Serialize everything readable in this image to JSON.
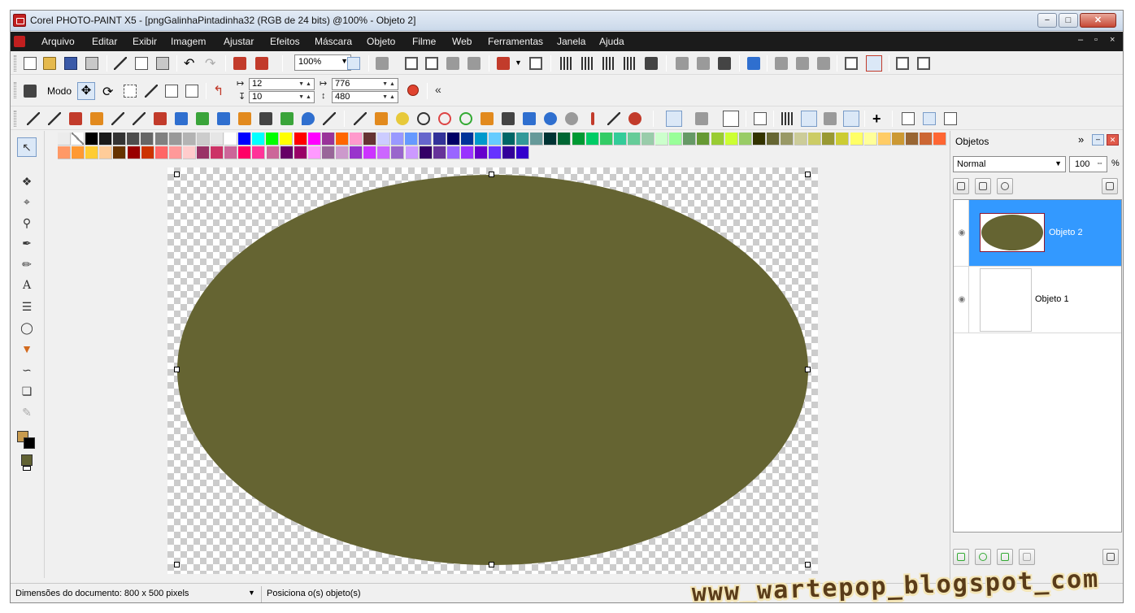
{
  "window": {
    "title": "Corel PHOTO-PAINT X5 - [pngGalinhaPintadinha32 (RGB de 24 bits) @100% - Objeto 2]",
    "controls": {
      "minimize": "−",
      "maximize": "□",
      "close": "✕"
    }
  },
  "menu": {
    "items": [
      "Arquivo",
      "Editar",
      "Exibir",
      "Imagem",
      "Ajustar",
      "Efeitos",
      "Máscara",
      "Objeto",
      "Filme",
      "Web",
      "Ferramentas",
      "Janela",
      "Ajuda"
    ],
    "doc_controls": [
      "–",
      "▫",
      "×"
    ]
  },
  "toolbar_standard": {
    "zoom": "100%"
  },
  "property_bar": {
    "mode_label": "Modo",
    "pos_x": "12",
    "pos_y": "10",
    "width": "776",
    "height": "480"
  },
  "palette_colors": [
    "#000000",
    "#1a1a1a",
    "#333333",
    "#4d4d4d",
    "#666666",
    "#808080",
    "#999999",
    "#b3b3b3",
    "#cccccc",
    "#e6e6e6",
    "#ffffff",
    "#0000ff",
    "#00ffff",
    "#00ff00",
    "#ffff00",
    "#ff0000",
    "#ff00ff",
    "#993399",
    "#ff6600",
    "#ff99cc",
    "#663333",
    "#ccccff",
    "#9999ff",
    "#6699ff",
    "#6666cc",
    "#333399",
    "#000066",
    "#003399",
    "#0099cc",
    "#66ccff",
    "#006666",
    "#339999",
    "#669999",
    "#003333",
    "#006633",
    "#009933",
    "#00cc66",
    "#33cc66",
    "#33cc99",
    "#66cc99",
    "#99ccaa",
    "#ccffcc",
    "#99ff99",
    "#669966",
    "#669933",
    "#99cc33",
    "#ccff33",
    "#99cc66",
    "#333300",
    "#666633",
    "#999966",
    "#cccc99",
    "#cccc66",
    "#999933",
    "#cccc33",
    "#ffff66",
    "#ffff99",
    "#ffcc66",
    "#cc9933",
    "#996633",
    "#cc6633",
    "#ff6633",
    "#ff9966",
    "#ff9933",
    "#ffcc33",
    "#ffcc99",
    "#663300",
    "#990000",
    "#cc3300",
    "#ff6666",
    "#ff9999",
    "#ffcccc",
    "#993366",
    "#cc3366",
    "#cc6699",
    "#ff0066",
    "#ff3399",
    "#cc6699",
    "#660066",
    "#990066",
    "#ff99ff",
    "#996699",
    "#cc99cc",
    "#9933cc",
    "#cc33ff",
    "#cc66ff",
    "#9966cc",
    "#cc99ff",
    "#330066",
    "#663399",
    "#9966ff",
    "#9933ff",
    "#6600cc",
    "#6633ff",
    "#330099",
    "#3300cc"
  ],
  "status": {
    "doc_info": "Dimensões do documento: 800 x 500 pixels",
    "message": "Posiciona o(s) objeto(s)"
  },
  "docker": {
    "title": "Objetos",
    "blend_mode": "Normal",
    "opacity": "100",
    "percent": "%",
    "objects": [
      {
        "name": "Objeto 2",
        "selected": true
      },
      {
        "name": "Objeto 1",
        "selected": false
      }
    ]
  },
  "canvas": {
    "shape_color": "#656432"
  },
  "watermark": "www_wartepop_blogspot_com"
}
